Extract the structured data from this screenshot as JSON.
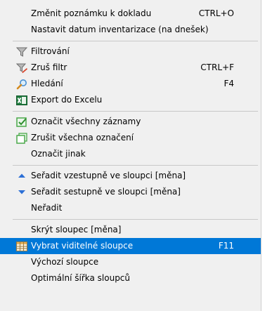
{
  "menu": {
    "items": [
      {
        "label": "Změnit poznámku k dokladu",
        "shortcut": "CTRL+O",
        "icon": ""
      },
      {
        "label": "Nastavit datum inventarizace (na dnešek)",
        "shortcut": "",
        "icon": ""
      },
      {
        "label": "Filtrování",
        "shortcut": "",
        "icon": "funnel-icon"
      },
      {
        "label": "Zruš filtr",
        "shortcut": "CTRL+F",
        "icon": "funnel-remove-icon"
      },
      {
        "label": "Hledání",
        "shortcut": "F4",
        "icon": "magnifier-icon"
      },
      {
        "label": "Export do Excelu",
        "shortcut": "",
        "icon": "excel-icon"
      },
      {
        "label": "Označit všechny záznamy",
        "shortcut": "",
        "icon": "select-all-icon"
      },
      {
        "label": "Zrušit všechna označení",
        "shortcut": "",
        "icon": "deselect-all-icon"
      },
      {
        "label": "Označit jinak",
        "shortcut": "",
        "icon": ""
      },
      {
        "label": "Seřadit vzestupně ve sloupci [měna]",
        "shortcut": "",
        "icon": "sort-ascending-icon"
      },
      {
        "label": "Seřadit sestupně ve sloupci [měna]",
        "shortcut": "",
        "icon": "sort-descending-icon"
      },
      {
        "label": "Neřadit",
        "shortcut": "",
        "icon": ""
      },
      {
        "label": "Skrýt sloupec [měna]",
        "shortcut": "",
        "icon": ""
      },
      {
        "label": "Vybrat viditelné sloupce",
        "shortcut": "F11",
        "icon": "columns-icon"
      },
      {
        "label": "Výchozí sloupce",
        "shortcut": "",
        "icon": ""
      },
      {
        "label": "Optimální šířka sloupců",
        "shortcut": "",
        "icon": ""
      }
    ],
    "highlighted_index": 13
  },
  "colors": {
    "menu_background": "#f0f0f0",
    "highlight": "#0078d7",
    "separator": "#c8c8c8"
  }
}
